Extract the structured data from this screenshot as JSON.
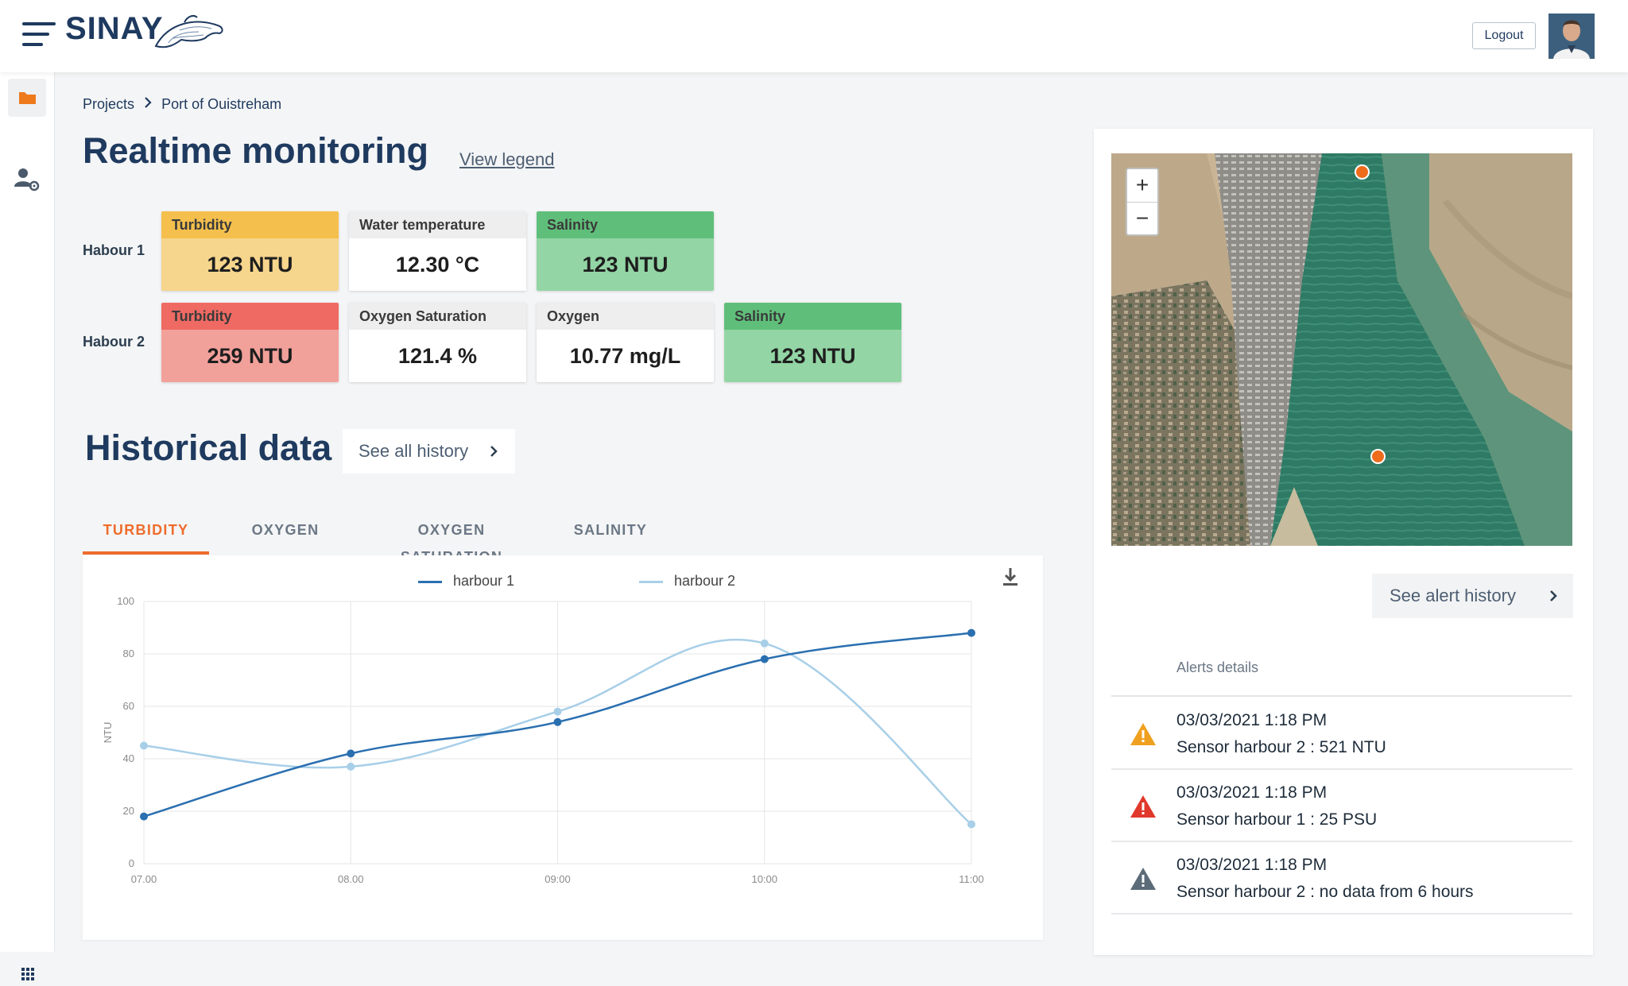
{
  "app": {
    "brand": "SINAY"
  },
  "header": {
    "logout_label": "Logout"
  },
  "breadcrumb": {
    "items": [
      "Projects",
      "Port of Ouistreham"
    ]
  },
  "realtime": {
    "title": "Realtime monitoring",
    "view_legend": "View legend",
    "harbours": [
      {
        "label": "Habour 1",
        "tiles": [
          {
            "name": "Turbidity",
            "value": "123 NTU",
            "status_color": "#f4bf4d"
          },
          {
            "name": "Water temperature",
            "value": "12.30 °C",
            "status_color": "#eeeeee"
          },
          {
            "name": "Salinity",
            "value": "123 NTU",
            "status_color": "#5fbf7a"
          }
        ]
      },
      {
        "label": "Habour 2",
        "tiles": [
          {
            "name": "Turbidity",
            "value": "259 NTU",
            "status_color": "#ef6a63"
          },
          {
            "name": "Oxygen Saturation",
            "value": "121.4 %",
            "status_color": "#eeeeee"
          },
          {
            "name": "Oxygen",
            "value": "10.77 mg/L",
            "status_color": "#eeeeee"
          },
          {
            "name": "Salinity",
            "value": "123 NTU",
            "status_color": "#5fbf7a"
          }
        ]
      }
    ]
  },
  "historical": {
    "title": "Historical data",
    "see_all_label": "See all history",
    "tabs": [
      {
        "label": "TURBIDITY",
        "active": true
      },
      {
        "label": "OXYGEN",
        "active": false
      },
      {
        "label": "OXYGEN SATURATION",
        "active": false
      },
      {
        "label": "SALINITY",
        "active": false
      }
    ]
  },
  "chart_data": {
    "type": "line",
    "x": [
      "07.00",
      "08.00",
      "09:00",
      "10:00",
      "11:00"
    ],
    "series": [
      {
        "name": "harbour 1",
        "values": [
          18,
          42,
          54,
          78,
          88
        ],
        "color": "#2a6fb0"
      },
      {
        "name": "harbour 2",
        "values": [
          45,
          37,
          58,
          84,
          15
        ],
        "color": "#a8cfe8"
      }
    ],
    "ylabel": "NTU",
    "xlabel": "",
    "ylim": [
      0,
      100
    ],
    "yticks": [
      0,
      20,
      40,
      60,
      80,
      100
    ],
    "grid": true,
    "legend": "top-center",
    "smooth": true
  },
  "alerts": {
    "see_history_label": "See alert history",
    "details_title": "Alerts details",
    "items": [
      {
        "date": "03/03/2021 1:18 PM",
        "message": "Sensor harbour 2 : 521 NTU",
        "level": "warning",
        "color": "#f0a020"
      },
      {
        "date": "03/03/2021 1:18 PM",
        "message": "Sensor harbour 1 : 25 PSU",
        "level": "critical",
        "color": "#e0392c"
      },
      {
        "date": "03/03/2021 1:18 PM",
        "message": "Sensor harbour 2 : no data from 6 hours",
        "level": "no-data",
        "color": "#5c6b78"
      }
    ]
  },
  "map": {
    "zoom_in": "+",
    "zoom_out": "−"
  },
  "icons": [
    "menu-icon",
    "dolphin-logo-icon",
    "folder-icon",
    "user-settings-icon",
    "apps-grid-icon",
    "chevron-right-icon",
    "download-icon",
    "warning-icon"
  ]
}
